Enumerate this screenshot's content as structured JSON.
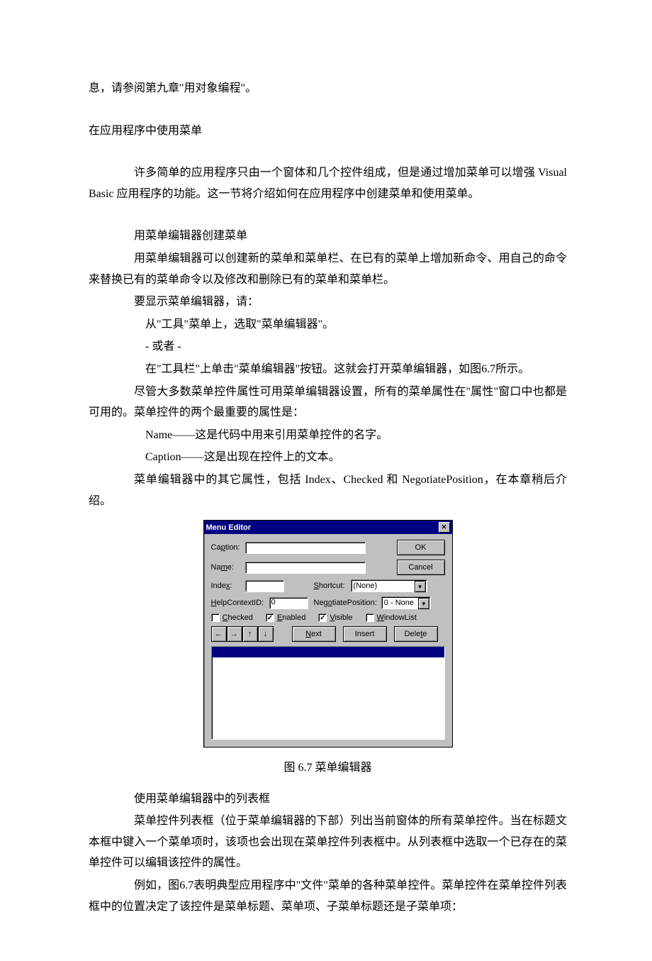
{
  "p1": "息，请参阅第九章\"用对象编程\"。",
  "h1": "在应用程序中使用菜单",
  "p2": "许多简单的应用程序只由一个窗体和几个控件组成，但是通过增加菜单可以增强 Visual Basic 应用程序的功能。这一节将介绍如何在应用程序中创建菜单和使用菜单。",
  "p3": "用菜单编辑器创建菜单",
  "p4": "用菜单编辑器可以创建新的菜单和菜单栏、在已有的菜单上增加新命令、用自己的命令来替换已有的菜单命令以及修改和删除已有的菜单和菜单栏。",
  "p5": "要显示菜单编辑器，请：",
  "p6": "从\"工具\"菜单上，选取\"菜单编辑器\"。",
  "p7": "- 或者 -",
  "p8": "在\"工具栏\"上单击\"菜单编辑器\"按钮。这就会打开菜单编辑器，如图6.7所示。",
  "p9": "尽管大多数菜单控件属性可用菜单编辑器设置，所有的菜单属性在\"属性\"窗口中也都是可用的。菜单控件的两个最重要的属性是：",
  "p10": "Name——这是代码中用来引用菜单控件的名字。",
  "p11": "Caption——这是出现在控件上的文本。",
  "p12": "菜单编辑器中的其它属性，包括 Index、Checked 和 NegotiatePosition，在本章稍后介绍。",
  "fig_caption": "图  6.7    菜单编辑器",
  "p13": "使用菜单编辑器中的列表框",
  "p14": "菜单控件列表框（位于菜单编辑器的下部）列出当前窗体的所有菜单控件。当在标题文本框中键入一个菜单项时，该项也会出现在菜单控件列表框中。从列表框中选取一个已存在的菜单控件可以编辑该控件的属性。",
  "p15": "例如，图6.7表明典型应用程序中\"文件\"菜单的各种菜单控件。菜单控件在菜单控件列表框中的位置决定了该控件是菜单标题、菜单项、子菜单标题还是子菜单项：",
  "dlg": {
    "title": "Menu Editor",
    "caption_lbl": "Caption:",
    "name_lbl": "Name:",
    "index_lbl": "Index:",
    "shortcut_lbl": "Shortcut:",
    "shortcut_val": "(None)",
    "help_lbl": "HelpContextID:",
    "help_val": "0",
    "negpos_lbl": "NegotiatePosition:",
    "negpos_val": "0 - None",
    "checked": "Checked",
    "enabled": "Enabled",
    "visible": "Visible",
    "windowlist": "WindowList",
    "ok": "OK",
    "cancel": "Cancel",
    "next": "Next",
    "insert": "Insert",
    "delete": "Delete"
  }
}
